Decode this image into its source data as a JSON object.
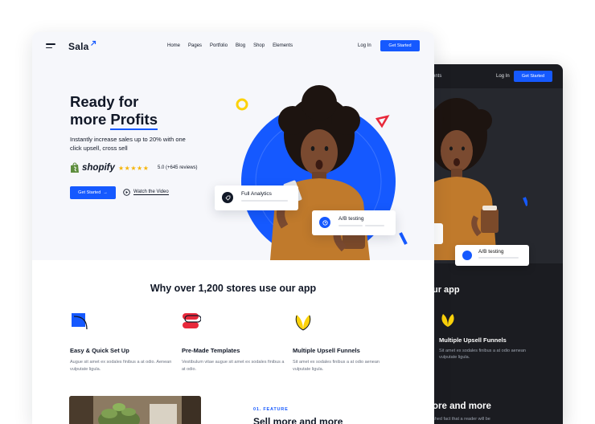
{
  "colors": {
    "accent": "#1559ff",
    "star": "#f5b50a",
    "red": "#e8293b",
    "yellow": "#fcd20a",
    "dark_bg": "#1b1c21"
  },
  "brand": {
    "name": "Sala",
    "mark_icon": "arrow-up-right-icon"
  },
  "nav": {
    "links": [
      "Home",
      "Pages",
      "Portfolio",
      "Blog",
      "Shop",
      "Elements"
    ],
    "login": "Log In",
    "cta": "Get Started"
  },
  "hero": {
    "title_line1": "Ready for",
    "title_line2_prefix": "more",
    "title_line2_highlight": "Profits",
    "subtitle": "Instantly increase sales up to 20% with one click upsell, cross sell",
    "partner": "shopify",
    "stars": "★★★★★",
    "rating": "5.0 (+645 reviews)",
    "cta": "Get Started",
    "cta_icon": "arrow-right-icon",
    "video_link": "Watch the Video",
    "video_icon": "play-circle-icon"
  },
  "cards": {
    "analytics": "Full Analytics",
    "ab_testing": "A/B testing"
  },
  "why": {
    "title": "Why over 1,200 stores use our app",
    "features": [
      {
        "icon": "setup-icon",
        "title": "Easy & Quick Set Up",
        "desc": "Augue sit amet ex sodales finibus a at odio. Aenean vulputate ligula."
      },
      {
        "icon": "templates-icon",
        "title": "Pre-Made Templates",
        "desc": "Vestibulum vitae augue sit amet ex sodales finibus a at odio."
      },
      {
        "icon": "funnel-icon",
        "title": "Multiple Upsell Funnels",
        "desc": "Sit amet ex sodales finibus a at odio aenean vulputate ligula."
      }
    ]
  },
  "feature_section": {
    "kicker": "01. FEATURE",
    "title": "Sell more and more"
  },
  "dark_preview": {
    "nav_fragment": "ents",
    "login": "Log In",
    "cta": "Get Started",
    "ab_testing": "A/B testing",
    "why_fragment": "ur app",
    "feature_title": "Multiple Upsell Funnels",
    "feature_desc": "Sit amet ex sodales finibus a at odio aenean vulputate ligula.",
    "sell_fragment": "ore and more",
    "sell_sub_fragment": "shed fact that a reader will be"
  }
}
